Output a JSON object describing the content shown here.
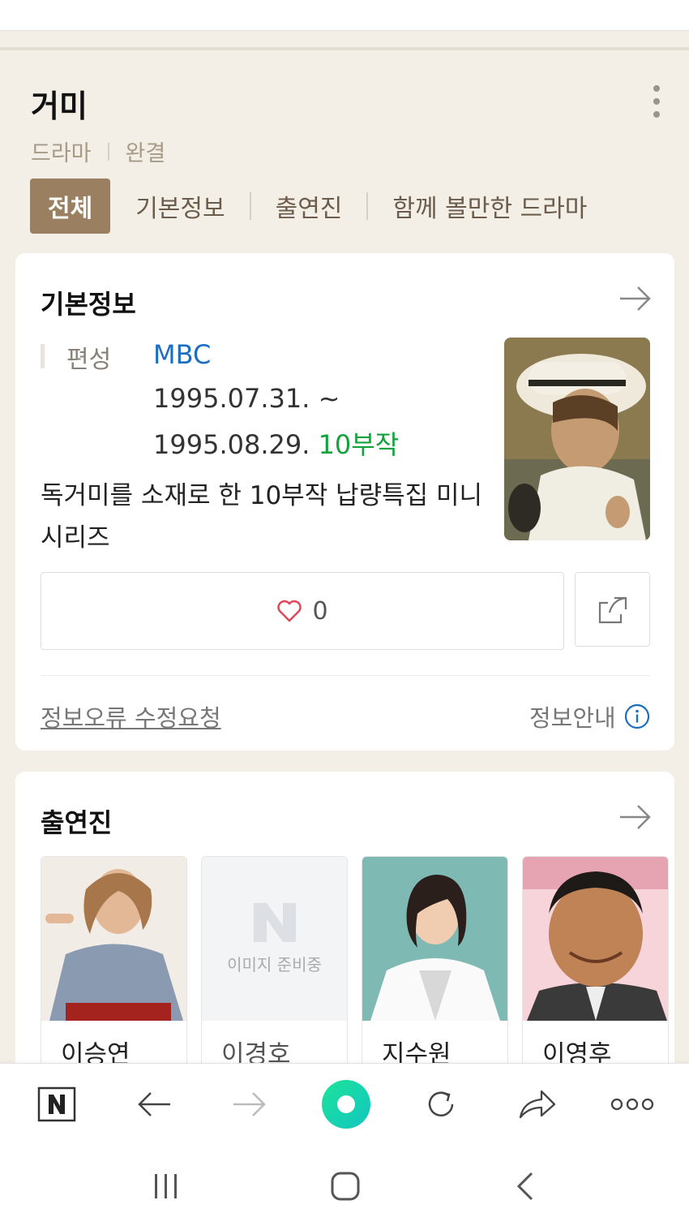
{
  "header": {
    "title": "거미",
    "genre": "드라마",
    "status": "완결"
  },
  "tabs": [
    {
      "label": "전체",
      "active": true
    },
    {
      "label": "기본정보"
    },
    {
      "label": "출연진"
    },
    {
      "label": "함께 볼만한 드라마"
    }
  ],
  "basic_info": {
    "section_title": "기본정보",
    "label": "편성",
    "station": "MBC",
    "date_start": "1995.07.31. ~",
    "date_end": "1995.08.29.",
    "episodes": "10부작",
    "description": "독거미를 소재로 한 10부작 납량특집 미니시리즈",
    "like_count": "0",
    "report_link": "정보오류 수정요청",
    "info_guide": "정보안내"
  },
  "cast": {
    "section_title": "출연진",
    "placeholder_text": "이미지 준비중",
    "members": [
      {
        "name": "이승연"
      },
      {
        "name": "이경호"
      },
      {
        "name": "지수원"
      },
      {
        "name": "이영후"
      }
    ]
  },
  "colors": {
    "accent": "#9b7f61",
    "link_blue": "#1b6ec2",
    "episodes_green": "#12a33c",
    "heart_red": "#e0475b",
    "background": "#f3efe7"
  }
}
